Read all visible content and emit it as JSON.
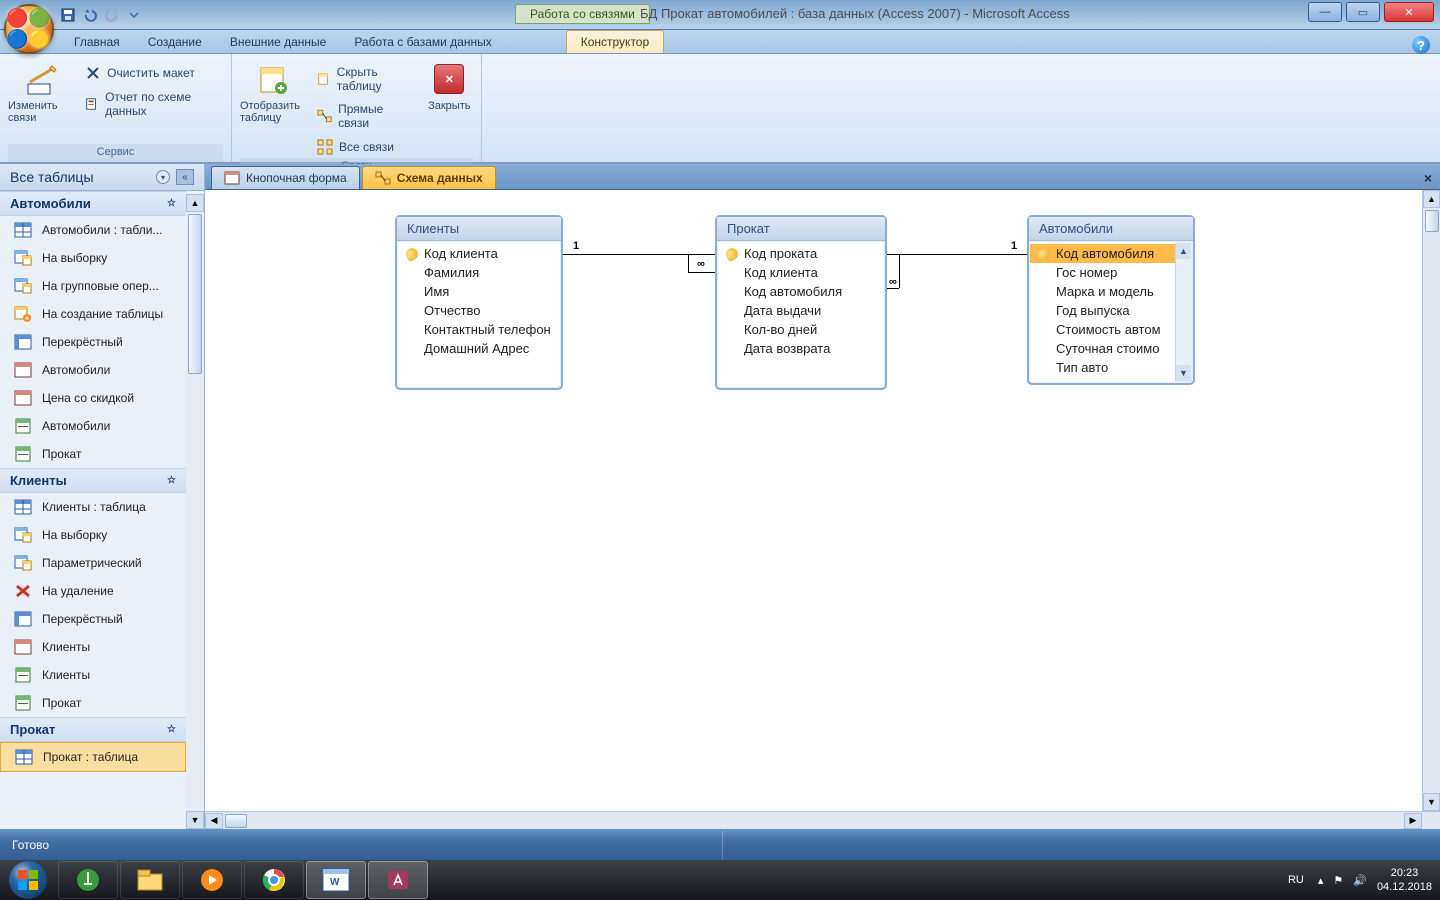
{
  "titlebar": {
    "context_tab": "Работа со связями",
    "title": "БД Прокат автомобилей : база данных (Access 2007) - Microsoft Access"
  },
  "ribbon_tabs": {
    "home": "Главная",
    "create": "Создание",
    "external": "Внешние данные",
    "dbtools": "Работа с базами данных",
    "design": "Конструктор"
  },
  "ribbon": {
    "edit_rel": "Изменить связи",
    "clear_layout": "Очистить макет",
    "rel_report": "Отчет по схеме данных",
    "group_service": "Сервис",
    "show_table": "Отобразить таблицу",
    "hide_table": "Скрыть таблицу",
    "direct_rel": "Прямые связи",
    "all_rel": "Все связи",
    "group_rel": "Связи",
    "close": "Закрыть"
  },
  "navpane": {
    "header": "Все таблицы",
    "groups": [
      {
        "title": "Автомобили",
        "items": [
          "Автомобили : табли...",
          "На выборку",
          "На групповые опер...",
          "На создание таблицы",
          "Перекрёстный",
          "Автомобили",
          "Цена со скидкой",
          "Автомобили",
          "Прокат"
        ]
      },
      {
        "title": "Клиенты",
        "items": [
          "Клиенты : таблица",
          "На выборку",
          "Параметрический",
          "На удаление",
          "Перекрёстный",
          "Клиенты",
          "Клиенты",
          "Прокат"
        ]
      },
      {
        "title": "Прокат",
        "items": [
          "Прокат : таблица"
        ]
      }
    ]
  },
  "doctabs": {
    "form": "Кнопочная форма",
    "relations": "Схема данных"
  },
  "tables": {
    "clients": {
      "title": "Клиенты",
      "fields": [
        "Код клиента",
        "Фамилия",
        "Имя",
        "Отчество",
        "Контактный телефон",
        "Домашний Адрес"
      ]
    },
    "rental": {
      "title": "Прокат",
      "fields": [
        "Код проката",
        "Код клиента",
        "Код автомобиля",
        "Дата выдачи",
        "Кол-во дней",
        "Дата возврата"
      ]
    },
    "cars": {
      "title": "Автомобили",
      "fields": [
        "Код автомобиля",
        "Гос номер",
        "Марка и модель",
        "Год выпуска",
        "Стоимость автом",
        "Суточная стоимо",
        "Тип авто"
      ]
    }
  },
  "rel_labels": {
    "one": "1",
    "many": "∞"
  },
  "statusbar": {
    "ready": "Готово"
  },
  "taskbar": {
    "lang": "RU",
    "time": "20:23",
    "date": "04.12.2018"
  }
}
